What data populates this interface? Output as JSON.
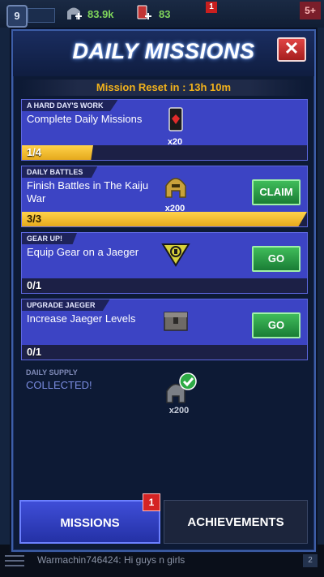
{
  "hud": {
    "level": "9",
    "resource_1": {
      "value": "83.9k",
      "icon": "helmet-plus-icon"
    },
    "resource_2": {
      "value": "83",
      "icon": "card-plus-icon"
    },
    "notification_count": "1",
    "extra_badge": "5+"
  },
  "modal": {
    "title": "DAILY MISSIONS",
    "close_label": "✕",
    "reset_text": "Mission Reset in : 13h 10m"
  },
  "missions": [
    {
      "category": "A HARD DAY'S WORK",
      "description": "Complete Daily Missions",
      "reward_qty": "x20",
      "reward_icon": "red-card-icon",
      "progress_text": "1/4",
      "progress": 0.25,
      "action": ""
    },
    {
      "category": "DAILY BATTLES",
      "description": "Finish Battles in The Kaiju War",
      "reward_qty": "x200",
      "reward_icon": "gold-helmet-icon",
      "progress_text": "3/3",
      "progress": 1.0,
      "action": "CLAIM"
    },
    {
      "category": "GEAR UP!",
      "description": "Equip Gear on a Jaeger",
      "reward_qty": "",
      "reward_icon": "gear-emblem-icon",
      "progress_text": "0/1",
      "progress": 0.0,
      "action": "GO"
    },
    {
      "category": "UPGRADE JAEGER",
      "description": "Increase Jaeger Levels",
      "reward_qty": "",
      "reward_icon": "crate-icon",
      "progress_text": "0/1",
      "progress": 0.0,
      "action": "GO"
    }
  ],
  "daily_supply": {
    "category": "DAILY SUPPLY",
    "status": "COLLECTED!",
    "reward_qty": "x200",
    "reward_icon": "helmet-check-icon"
  },
  "tabs": {
    "missions": "MISSIONS",
    "achievements": "ACHIEVEMENTS",
    "missions_badge": "1"
  },
  "chat": {
    "message": "Warmachin746424: Hi guys n girls",
    "unread": "2"
  },
  "colors": {
    "card_bg": "#3c44c4",
    "progress_gold": "#f2b21b",
    "claim_green": "#2aa14a",
    "close_red": "#c42e2e"
  }
}
